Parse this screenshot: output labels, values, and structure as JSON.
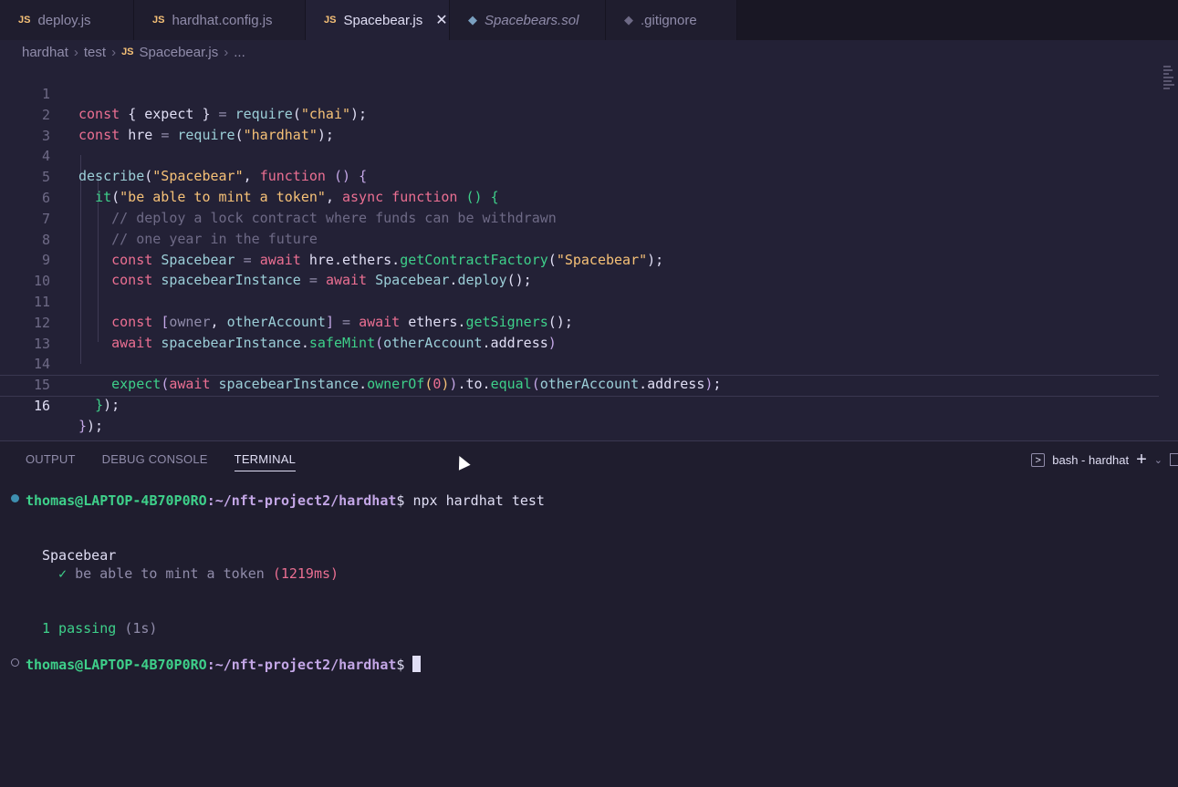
{
  "tabs": [
    {
      "icon": "JS",
      "label": "deploy.js",
      "active": false
    },
    {
      "icon": "JS",
      "label": "hardhat.config.js",
      "active": false
    },
    {
      "icon": "JS",
      "label": "Spacebear.js",
      "active": true,
      "close": "✕"
    },
    {
      "icon": "◆",
      "label": "Spacebears.sol",
      "active": false
    },
    {
      "icon": "◆",
      "label": ".gitignore",
      "active": false
    }
  ],
  "breadcrumb": [
    "hardhat",
    "test",
    "Spacebear.js",
    "..."
  ],
  "breadcrumb_icon": "JS",
  "editor": {
    "line_numbers": [
      "1",
      "2",
      "3",
      "4",
      "5",
      "6",
      "7",
      "8",
      "9",
      "10",
      "11",
      "12",
      "13",
      "14",
      "15",
      "16"
    ],
    "current_line": 16
  },
  "panel": {
    "tabs": [
      "OUTPUT",
      "DEBUG CONSOLE",
      "TERMINAL"
    ],
    "active_tab": "TERMINAL",
    "terminal_name": "bash - hardhat",
    "terminal_icon": "terminal-icon"
  },
  "terminal": {
    "user": "thomas@LAPTOP-4B70P0RO",
    "path": ":~/nft-project2/hardhat",
    "dollar": "$",
    "command": " npx hardhat test",
    "suite": "Spacebear",
    "check": "✓",
    "test_name": "be able to mint a token",
    "test_time": "(1219ms)",
    "passing": "1 passing",
    "passing_time": "(1s)"
  },
  "colors": {
    "editor_bg": "#232136",
    "panel_bg": "#1f1d2e",
    "keyword": "#eb6f92",
    "string": "#f6c177",
    "function": "#9ccfd8",
    "prompt_user": "#3ed08a",
    "prompt_path": "#c4a7e7"
  }
}
